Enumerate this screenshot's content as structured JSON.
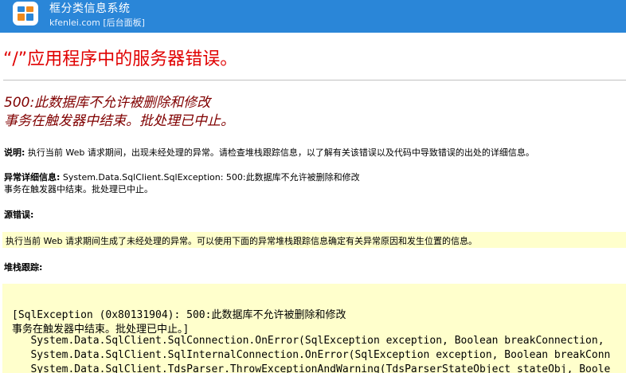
{
  "header": {
    "site_name": "框分类信息系统",
    "site_sub": "kfenlei.com [后台面板]",
    "bg_color": "#2a86d8",
    "logo_icon": "kfenlei-logo-icon"
  },
  "error": {
    "title": "“/”应用程序中的服务器错误。",
    "message_line1": "500:此数据库不允许被删除和修改",
    "message_line2": "事务在触发器中结束。批处理已中止。"
  },
  "description": {
    "label": "说明:",
    "text": " 执行当前 Web 请求期间，出现未经处理的异常。请检查堆栈跟踪信息，以了解有关该错误以及代码中导致错误的出处的详细信息。"
  },
  "exception": {
    "label": "异常详细信息:",
    "text": " System.Data.SqlClient.SqlException: 500:此数据库不允许被删除和修改",
    "text2": "事务在触发器中结束。批处理已中止。"
  },
  "source_error": {
    "label": "源错误:",
    "text": "执行当前 Web 请求期间生成了未经处理的异常。可以使用下面的异常堆栈跟踪信息确定有关异常原因和发生位置的信息。"
  },
  "stack_trace": {
    "label": "堆栈跟踪:",
    "lines": [
      "[SqlException (0x80131904): 500:此数据库不允许被删除和修改",
      "事务在触发器中结束。批处理已中止。]",
      "   System.Data.SqlClient.SqlConnection.OnError(SqlException exception, Boolean breakConnection, ",
      "   System.Data.SqlClient.SqlInternalConnection.OnError(SqlException exception, Boolean breakConn",
      "   System.Data.SqlClient.TdsParser.ThrowExceptionAndWarning(TdsParserStateObject stateObj, Boole"
    ]
  }
}
